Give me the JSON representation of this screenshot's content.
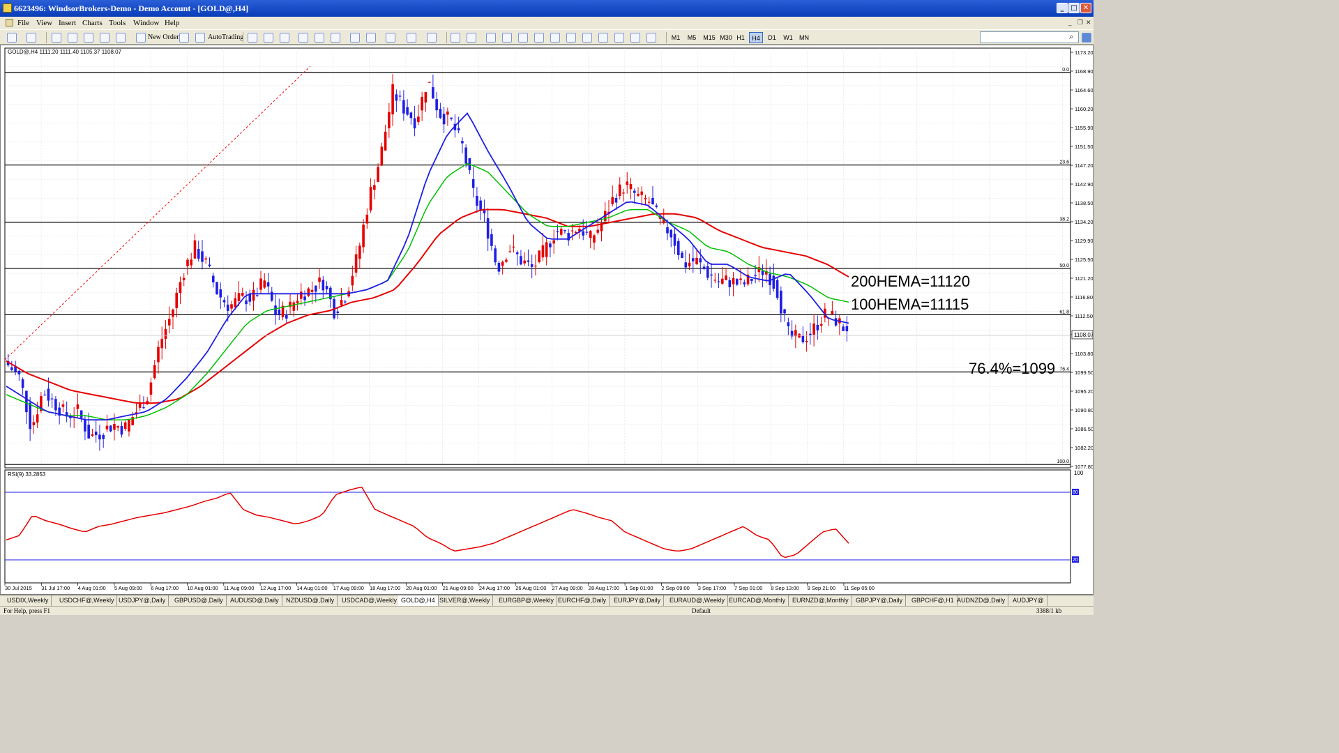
{
  "window": {
    "title": "6623496: WindsorBrokers-Demo - Demo Account - [GOLD@,H4]",
    "controls": [
      "_",
      "□",
      "✕"
    ]
  },
  "menu": [
    "File",
    "View",
    "Insert",
    "Charts",
    "Tools",
    "Window",
    "Help"
  ],
  "toolbar": {
    "new_order": "New Order",
    "autotrading": "AutoTrading",
    "timeframes": [
      "M1",
      "M5",
      "M15",
      "M30",
      "H1",
      "H4",
      "D1",
      "W1",
      "MN"
    ],
    "active_timeframe": "H4",
    "search_placeholder": ""
  },
  "chart": {
    "header": "GOLD@,H4  1111.20 1111.40 1105.37 1108.07",
    "current_price": "1108.07",
    "price_axis": [
      "1173.20",
      "1168.90",
      "1164.60",
      "1160.20",
      "1155.90",
      "1151.50",
      "1147.20",
      "1142.90",
      "1138.50",
      "1134.20",
      "1129.90",
      "1125.50",
      "1121.20",
      "1116.80",
      "1112.50",
      "1108.20",
      "1103.80",
      "1099.50",
      "1095.20",
      "1090.80",
      "1086.50",
      "1082.20",
      "1077.80"
    ],
    "time_axis": [
      "30 Jul 2015",
      "31 Jul 17:00",
      "4 Aug 01:00",
      "5 Aug 09:00",
      "6 Aug 17:00",
      "10 Aug 01:00",
      "11 Aug 09:00",
      "12 Aug 17:00",
      "14 Aug 01:00",
      "17 Aug 09:00",
      "18 Aug 17:00",
      "20 Aug 01:00",
      "21 Aug 09:00",
      "24 Aug 17:00",
      "26 Aug 01:00",
      "27 Aug 09:00",
      "28 Aug 17:00",
      "1 Sep 01:00",
      "2 Sep 09:00",
      "3 Sep 17:00",
      "7 Sep 01:00",
      "8 Sep 13:00",
      "9 Sep 21:00",
      "11 Sep 05:00"
    ],
    "fib_levels": [
      {
        "label": "0.0",
        "price": 1169.6
      },
      {
        "label": "23.6",
        "price": 1147.6
      },
      {
        "label": "38.2",
        "price": 1134.0
      },
      {
        "label": "50.0",
        "price": 1123.0
      },
      {
        "label": "61.8",
        "price": 1112.0
      },
      {
        "label": "76.4",
        "price": 1098.4
      },
      {
        "label": "100.0",
        "price": 1076.4
      }
    ],
    "annotations": {
      "hema200": "200HEMA=11120",
      "hema100": "100HEMA=11115",
      "fib764": "76.4%=1099"
    },
    "colors": {
      "up": "#e60000",
      "down": "#1e1ee6",
      "ema_fast": "#1e1ee6",
      "ema_mid": "#00c000",
      "ema_slow": "#e60000",
      "fib": "#000000",
      "trend": "#ff0000"
    }
  },
  "rsi": {
    "header": "RSI(9) 33.2853",
    "scale": {
      "top": "100",
      "upper": "80",
      "lower": "20"
    }
  },
  "tabs": [
    "USDIX,Weekly",
    "USDCHF@,Weekly",
    "USDJPY@,Daily",
    "GBPUSD@,Daily",
    "AUDUSD@,Daily",
    "NZDUSD@,Daily",
    "USDCAD@,Weekly",
    "GOLD@,H4",
    "SILVER@,Weekly",
    "EURGBP@,Weekly",
    "EURCHF@,Daily",
    "EURJPY@,Daily",
    "EURAUD@,Weekly",
    "EURCAD@,Monthly",
    "EURNZD@,Monthly",
    "GBPJPY@,Daily",
    "GBPCHF@,H1",
    "AUDNZD@,Daily",
    "AUDJPY@"
  ],
  "active_tab": "GOLD@,H4",
  "status": {
    "help": "For Help, press F1",
    "profile": "Default",
    "traffic": "3388/1 kb"
  },
  "chart_data": {
    "type": "candlestick",
    "ohlc_anchors": [
      1100,
      1097,
      1085,
      1094,
      1091,
      1088,
      1089,
      1083,
      1084,
      1086,
      1085,
      1089,
      1093,
      1105,
      1112,
      1122,
      1128,
      1124,
      1117,
      1114,
      1116,
      1116,
      1120,
      1112,
      1113,
      1117,
      1118,
      1120,
      1113,
      1117,
      1126,
      1140,
      1150,
      1165,
      1161,
      1158,
      1168,
      1160,
      1158,
      1152,
      1140,
      1134,
      1123,
      1128,
      1125,
      1123,
      1127,
      1132,
      1131,
      1133,
      1130,
      1134,
      1140,
      1143,
      1140,
      1139,
      1134,
      1131,
      1124,
      1125,
      1122,
      1120,
      1120,
      1119,
      1121,
      1123,
      1118,
      1107,
      1106,
      1108,
      1112,
      1111,
      1108
    ],
    "close": 1108.07,
    "ema_fast_anchors": [
      1095,
      1092,
      1089,
      1088,
      1087,
      1087,
      1088,
      1089,
      1092,
      1097,
      1103,
      1111,
      1117,
      1117,
      1117,
      1117,
      1117,
      1117,
      1118,
      1120,
      1130,
      1145,
      1155,
      1160,
      1151,
      1143,
      1134,
      1130,
      1130,
      1133,
      1136,
      1139,
      1138,
      1134,
      1130,
      1124,
      1124,
      1121,
      1120,
      1122,
      1117,
      1111,
      1110
    ],
    "ema_mid_anchors": [
      1093,
      1091,
      1089,
      1088,
      1088,
      1087,
      1087,
      1088,
      1090,
      1093,
      1098,
      1104,
      1110,
      1113,
      1114,
      1115,
      1116,
      1117,
      1118,
      1120,
      1127,
      1138,
      1145,
      1148,
      1146,
      1141,
      1136,
      1133,
      1133,
      1134,
      1135,
      1137,
      1137,
      1134,
      1132,
      1128,
      1127,
      1124,
      1122,
      1121,
      1119,
      1116,
      1115
    ],
    "ema_slow_anchors": [
      1101,
      1098,
      1096,
      1094,
      1093,
      1092,
      1091,
      1091,
      1092,
      1095,
      1099,
      1103,
      1107,
      1110,
      1112,
      1113,
      1115,
      1116,
      1118,
      1124,
      1131,
      1135,
      1137,
      1137,
      1136,
      1135,
      1133,
      1133,
      1134,
      1135,
      1136,
      1136,
      1135,
      1132,
      1130,
      1128,
      1127,
      1126,
      1124,
      1121
    ],
    "rsi_anchors": [
      38,
      42,
      60,
      55,
      52,
      48,
      45,
      50,
      52,
      55,
      58,
      60,
      62,
      65,
      68,
      72,
      75,
      80,
      65,
      60,
      58,
      55,
      52,
      55,
      60,
      78,
      82,
      85,
      65,
      60,
      55,
      50,
      40,
      35,
      28,
      30,
      32,
      35,
      40,
      45,
      50,
      55,
      60,
      65,
      62,
      58,
      55,
      45,
      40,
      35,
      30,
      28,
      30,
      35,
      40,
      45,
      50,
      42,
      38,
      22,
      25,
      35,
      45,
      48,
      35
    ]
  }
}
